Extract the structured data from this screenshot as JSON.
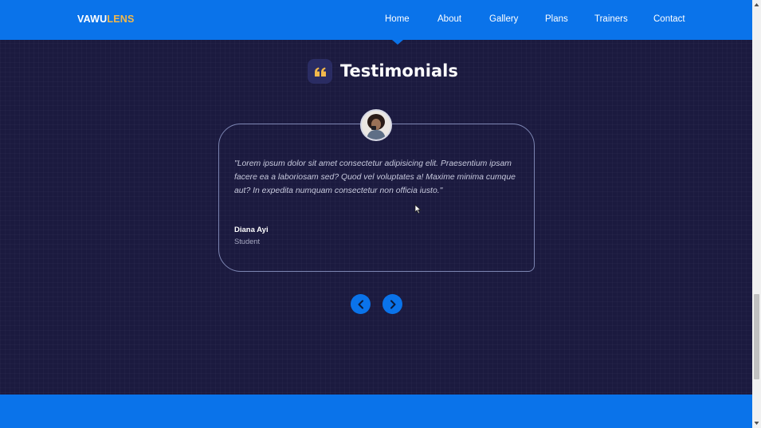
{
  "header": {
    "logo_main": "VAWU",
    "logo_accent": "LENS",
    "nav": [
      {
        "label": "Home"
      },
      {
        "label": "About"
      },
      {
        "label": "Gallery"
      },
      {
        "label": "Plans"
      },
      {
        "label": "Trainers"
      },
      {
        "label": "Contact"
      }
    ],
    "active_item": "Home"
  },
  "section": {
    "title": "Testimonials",
    "icon": "quote-icon"
  },
  "testimonial": {
    "quote": "\"Lorem ipsum dolor sit amet consectetur adipisicing elit. Praesentium ipsam facere ea a laboriosam sed? Quod vel voluptates a! Maxime minima cumque aut? In expedita numquam consectetur non officia iusto.\"",
    "name": "Diana Ayi",
    "role": "Student",
    "avatar": "avatar-photo"
  },
  "controls": {
    "prev_icon": "chevron-left-icon",
    "next_icon": "chevron-right-icon"
  },
  "colors": {
    "primary": "#0a73ea",
    "background": "#1b1a3f",
    "logo_accent": "#f2b84b",
    "quote_icon": "#f2b84b",
    "card_border": "#7d86b3"
  }
}
